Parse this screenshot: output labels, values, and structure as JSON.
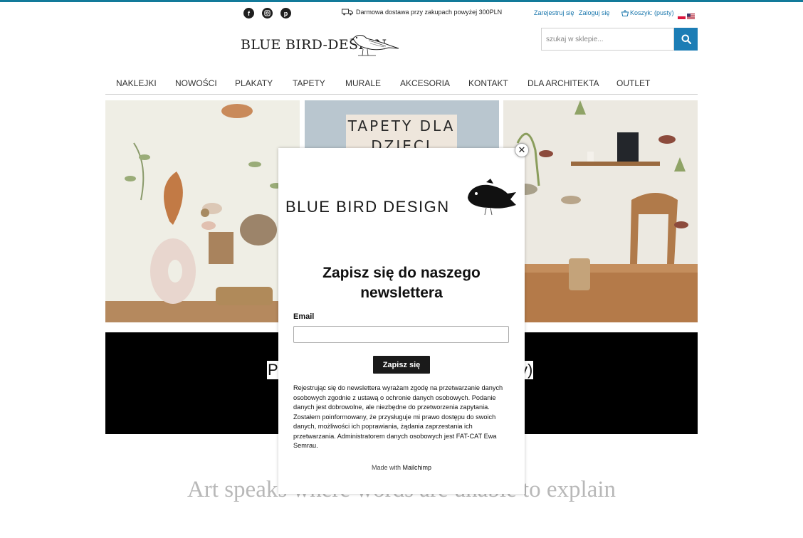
{
  "header": {
    "social_icons": [
      "facebook-icon",
      "instagram-icon",
      "pinterest-icon"
    ],
    "shipping_text": "Darmowa dostawa przy zakupach powyżej 300PLN",
    "register_label": "Zarejestruj się",
    "login_label": "Zaloguj się",
    "cart_label": "Koszyk: (pusty)",
    "languages": [
      "pl",
      "en"
    ],
    "logo_text": "BLUE BIRD-DESIGN",
    "search_placeholder": "szukaj w sklepie...",
    "accent_color": "#1c7db5"
  },
  "nav": {
    "items": [
      "NAKLEJKI",
      "NOWOŚCI",
      "PLAKATY",
      "TAPETY",
      "MURALE",
      "AKCESORIA",
      "KONTAKT",
      "DLA ARCHITEKTA",
      "OUTLET"
    ]
  },
  "panels": {
    "middle_sign_text": "TAPETY DLA DZIECI"
  },
  "banner": {
    "text_left": "P",
    "text_right": "y)"
  },
  "quote": "Art speaks where words are unable to explain",
  "modal": {
    "brand": "BLUE BIRD DESIGN",
    "title": "Zapisz się do naszego newslettera",
    "email_label": "Email",
    "email_value": "",
    "subscribe_label": "Zapisz się",
    "legal_text": "Rejestrując się do newslettera wyrażam zgodę na przetwarzanie danych osobowych zgodnie z ustawą o ochronie danych osobowych. Podanie danych jest dobrowolne, ale niezbędne do przetworzenia zapytania. Zostałem poinformowany, że przysługuje mi prawo dostępu do swoich danych, możliwości ich poprawiania, żądania zaprzestania ich przetwarzania. Administratorem danych osobowych jest FAT-CAT Ewa Semrau.",
    "made_with_prefix": "Made with",
    "made_with_brand": "Mailchimp",
    "close_icon": "close-icon"
  }
}
